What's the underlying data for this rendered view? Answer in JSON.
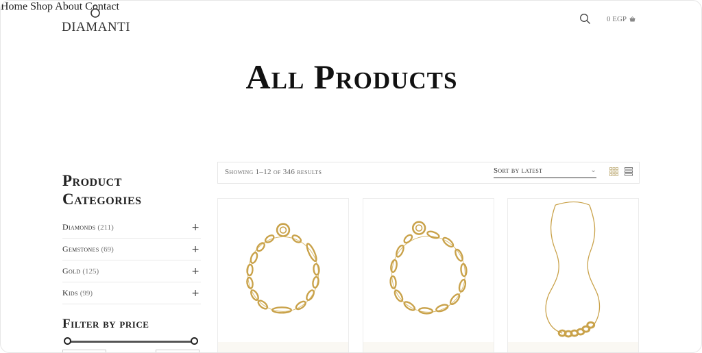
{
  "brand": {
    "name": "DIAMANTI"
  },
  "nav": {
    "items": [
      "Home",
      "Shop",
      "About",
      "Contact"
    ]
  },
  "cart": {
    "label": "0 EGP"
  },
  "page": {
    "title": "All Products"
  },
  "sidebar": {
    "categories_title": "Product Categories",
    "categories": [
      {
        "name": "Diamonds",
        "count": "(211)"
      },
      {
        "name": "Gemstones",
        "count": "(69)"
      },
      {
        "name": "Gold",
        "count": "(125)"
      },
      {
        "name": "Kids",
        "count": "(99)"
      }
    ],
    "filter_title": "Filter by price"
  },
  "toolbar": {
    "results_text": "Showing 1–12 of 346 results",
    "sort_label": "Sort by latest"
  },
  "products": [
    {
      "image": "gold-chain-bracelet"
    },
    {
      "image": "gold-chain-bracelet"
    },
    {
      "image": "gold-chain-necklace"
    }
  ],
  "colors": {
    "gold": "#c9a24a",
    "grid_icon_active": "#c8b98c"
  }
}
